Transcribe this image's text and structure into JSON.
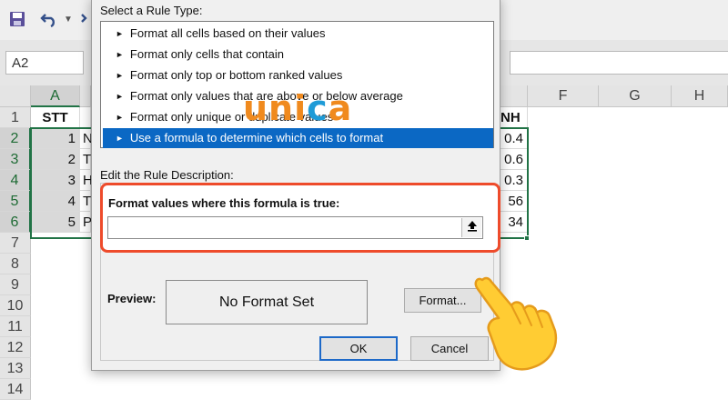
{
  "namebox": {
    "value": "A2"
  },
  "columns": [
    {
      "id": "A",
      "label": "A",
      "selected": true
    },
    {
      "id": "F",
      "label": "F",
      "selected": false
    },
    {
      "id": "G",
      "label": "G",
      "selected": false
    },
    {
      "id": "H",
      "label": "H",
      "selected": false
    }
  ],
  "rows": [
    "1",
    "2",
    "3",
    "4",
    "5",
    "6",
    "7",
    "8",
    "9",
    "10",
    "11",
    "12",
    "13",
    "14"
  ],
  "sheet": {
    "header_a": "STT",
    "header_right": "NH",
    "col_a": [
      "1",
      "2",
      "3",
      "4",
      "5"
    ],
    "col_b": [
      "N",
      "T",
      "H",
      "T",
      "P"
    ],
    "col_e": [
      "0.4",
      "0.6",
      "0.3",
      "56",
      "34"
    ]
  },
  "dialog": {
    "rule_type_label": "Select a Rule Type:",
    "rule_types": [
      "Format all cells based on their values",
      "Format only cells that contain",
      "Format only top or bottom ranked values",
      "Format only values that are above or below average",
      "Format only unique or duplicate values",
      "Use a formula to determine which cells to format"
    ],
    "selected_rule_index": 5,
    "description_label": "Edit the Rule Description:",
    "formula_label": "Format values where this formula is true:",
    "formula_value": "",
    "preview_label": "Preview:",
    "preview_text": "No Format Set",
    "format_button": "Format...",
    "ok_button": "OK",
    "cancel_button": "Cancel"
  },
  "watermark": {
    "part1": "uni",
    "part2": "c",
    "part3": "a"
  },
  "colors": {
    "selection": "#0b68c4",
    "highlight_border": "#ee4b2b",
    "excel_green": "#217346",
    "logo_orange": "#f08a1e",
    "logo_blue": "#1e9bd7"
  }
}
